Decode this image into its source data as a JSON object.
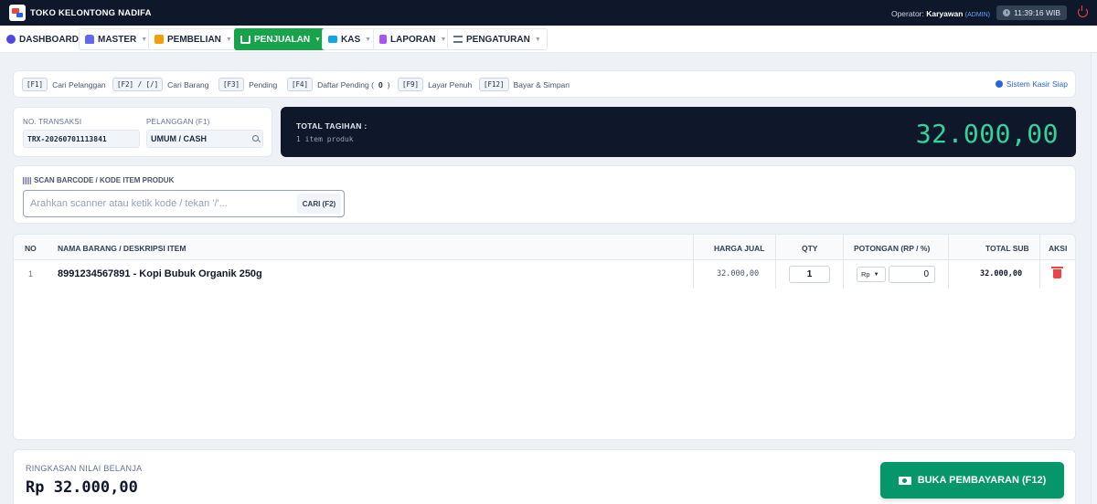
{
  "brand": {
    "name": "TOKO KELONTONG NADIFA"
  },
  "operator": {
    "prefix": "Operator:",
    "name": "Karyawan",
    "role": "(ADMIN)"
  },
  "clock": "11:39:16 WIB",
  "nav": {
    "dashboard": "DASHBOARD",
    "master": "MASTER",
    "pembelian": "PEMBELIAN",
    "penjualan": "PENJUALAN",
    "kas": "KAS",
    "laporan": "LAPORAN",
    "pengaturan": "PENGATURAN"
  },
  "shortcuts": [
    {
      "key": "[F1]",
      "label": "Cari Pelanggan"
    },
    {
      "key": "[F2] / [/]",
      "label": "Cari Barang"
    },
    {
      "key": "[F3]",
      "label": "Pending"
    },
    {
      "key": "[F4]",
      "label": "Daftar Pending (",
      "count": "0",
      "suffix": ")"
    },
    {
      "key": "[F9]",
      "label": "Layar Penuh"
    },
    {
      "key": "[F12]",
      "label": "Bayar & Simpan"
    }
  ],
  "status": "Sistem Kasir Siap",
  "transaction": {
    "no_label": "NO. TRANSAKSI",
    "no_value": "TRX-20260701113841",
    "customer_label": "PELANGGAN (F1)",
    "customer_value": "UMUM / CASH"
  },
  "total": {
    "label": "TOTAL TAGIHAN :",
    "sub": "1 item produk",
    "value": "32.000,00"
  },
  "scan": {
    "label": "SCAN BARCODE / KODE ITEM PRODUK",
    "placeholder": "Arahkan scanner atau ketik kode / tekan '/'...",
    "button": "CARI (F2)"
  },
  "table": {
    "headers": {
      "no": "NO",
      "name": "NAMA BARANG / DESKRIPSI ITEM",
      "price": "HARGA JUAL",
      "qty": "QTY",
      "discount": "POTONGAN (RP / %)",
      "subtotal": "TOTAL SUB",
      "action": "AKSI"
    },
    "rows": [
      {
        "no": "1",
        "name": "8991234567891 - Kopi Bubuk Organik 250g",
        "price": "32.000,00",
        "qty": "1",
        "disc_type": "Rp",
        "disc_value": "0",
        "subtotal": "32.000,00"
      }
    ]
  },
  "summary": {
    "label": "RINGKASAN NILAI BELANJA",
    "value": "Rp 32.000,00"
  },
  "pay_button": "BUKA PEMBAYARAN (F12)",
  "colors": {
    "topbar": "#0f172a",
    "accent_green": "#16a34a",
    "total_value": "#34d399",
    "pay_button": "#059669",
    "danger": "#ef4444"
  }
}
